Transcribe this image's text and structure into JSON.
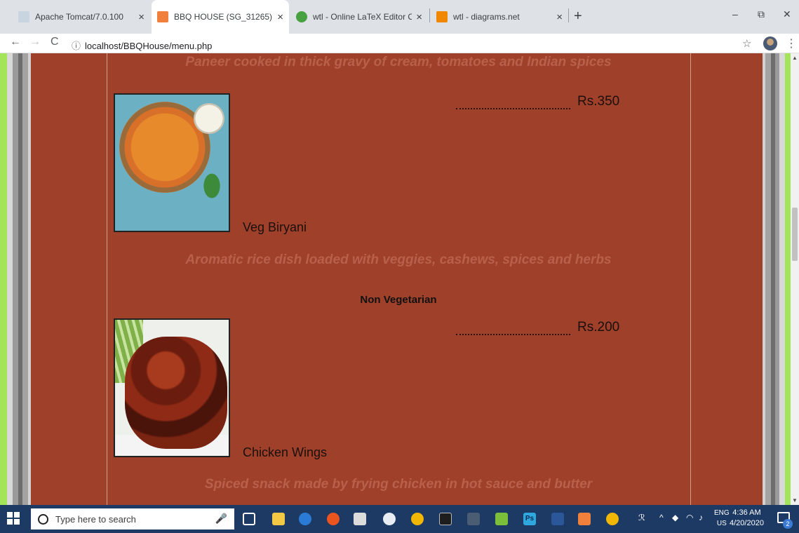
{
  "browser": {
    "tabs": [
      {
        "title": "Apache Tomcat/7.0.100",
        "close": "×",
        "favicon_color": "#c8d4e0"
      },
      {
        "title": "BBQ HOUSE (SG_31265)",
        "close": "×",
        "favicon_color": "#f0803c"
      },
      {
        "title": "wtl - Online LaTeX Editor Overle",
        "close": "×",
        "favicon_color": "#47a141"
      },
      {
        "title": "wtl - diagrams.net",
        "close": "×",
        "favicon_color": "#f08705"
      }
    ],
    "new_tab": "+",
    "minimize": "–",
    "restore": "⧉",
    "close": "✕",
    "back": "←",
    "forward": "→",
    "reload": "C",
    "url_info": "ⓘ",
    "url": "localhost/BBQHouse/menu.php",
    "bookmark_star": "☆",
    "menu": "⋮"
  },
  "menu": {
    "previous_description": "Paneer cooked in thick gravy of cream, tomatoes and Indian spices",
    "items": [
      {
        "name": "Veg Biryani",
        "price": "Rs.350",
        "description": "Aromatic rice dish loaded with veggies, cashews, spices and herbs"
      },
      {
        "name": "Chicken Wings",
        "price": "Rs.200",
        "description": "Spiced snack made by frying chicken in hot sauce and butter"
      }
    ],
    "section_heading": "Non Vegetarian"
  },
  "scrollbar": {
    "up": "▲",
    "down": "▼"
  },
  "taskbar": {
    "search_placeholder": "Type here to search",
    "mic": "🎙",
    "language_top": "ENG",
    "language_bottom": "US",
    "time": "4:36 AM",
    "date": "4/20/2020",
    "notification_count": "2",
    "tray_people": "ℛ",
    "tray_chevron": "^"
  },
  "colors": {
    "page_bg": "#9f412a",
    "outer_bg": "#a4e45a",
    "description_text": "#b8604a",
    "taskbar": "#1c3a63"
  }
}
